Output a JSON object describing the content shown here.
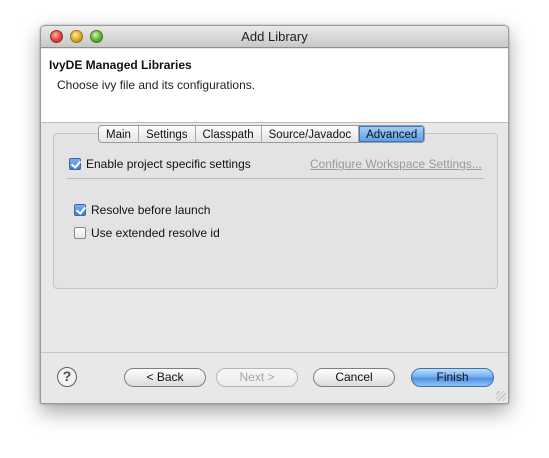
{
  "window": {
    "title": "Add Library"
  },
  "header": {
    "title": "IvyDE Managed Libraries",
    "description": "Choose ivy file and its configurations."
  },
  "tabs": [
    {
      "label": "Main",
      "active": false
    },
    {
      "label": "Settings",
      "active": false
    },
    {
      "label": "Classpath",
      "active": false
    },
    {
      "label": "Source/Javadoc",
      "active": false
    },
    {
      "label": "Advanced",
      "active": true
    }
  ],
  "advanced": {
    "enable_project_settings": {
      "label": "Enable project specific settings",
      "checked": true
    },
    "configure_workspace_link": "Configure Workspace Settings...",
    "resolve_before_launch": {
      "label": "Resolve before launch",
      "checked": true
    },
    "use_extended_resolve_id": {
      "label": "Use extended resolve id",
      "checked": false
    }
  },
  "footer": {
    "help_symbol": "?",
    "back_label": "< Back",
    "next_label": "Next >",
    "cancel_label": "Cancel",
    "finish_label": "Finish"
  },
  "colors": {
    "accent": "#4b8fe0",
    "link_disabled": "#9a9a9a"
  }
}
